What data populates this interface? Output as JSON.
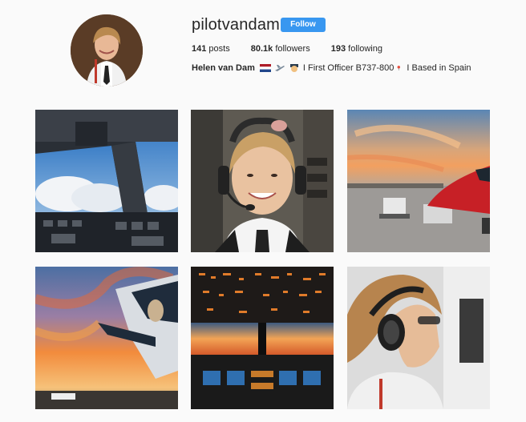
{
  "profile": {
    "username": "pilotvandam",
    "follow_label": "Follow",
    "stats": [
      {
        "value": "141",
        "label": "posts"
      },
      {
        "value": "80.1k",
        "label": "followers"
      },
      {
        "value": "193",
        "label": "following"
      }
    ],
    "bio": {
      "name": "Helen van Dam",
      "part1": "I First Officer B737-800",
      "part2": "I Based in Spain"
    }
  },
  "posts": [
    {
      "name": "post-cockpit-clouds"
    },
    {
      "name": "post-pilot-selfie"
    },
    {
      "name": "post-sunset-apron"
    },
    {
      "name": "post-tail-sunset"
    },
    {
      "name": "post-cockpit-dusk"
    },
    {
      "name": "post-pilot-headset"
    }
  ],
  "colors": {
    "accent": "#3897f0",
    "background": "#fafafa"
  }
}
